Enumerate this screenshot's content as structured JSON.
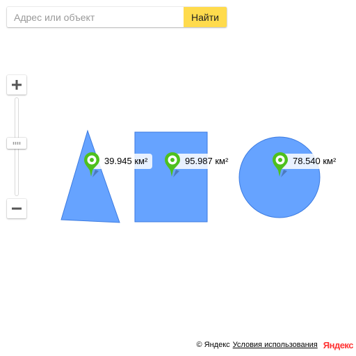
{
  "search": {
    "placeholder": "Адрес или объект",
    "button_label": "Найти"
  },
  "zoom": {
    "zoom_in_icon": "plus-icon",
    "zoom_out_icon": "minus-icon"
  },
  "shapes": [
    {
      "type": "triangle",
      "area_label": "39.945 км²"
    },
    {
      "type": "rectangle",
      "area_label": "95.987 км²"
    },
    {
      "type": "circle",
      "area_label": "78.540 км²"
    }
  ],
  "colors": {
    "shape_fill": "#66a3ff",
    "shape_stroke": "#3b7ae0",
    "pin_green": "#4ec01d",
    "search_button": "#ffdb4d",
    "brand_red": "#ff3333"
  },
  "footer": {
    "copyright": "© Яндекс",
    "terms": "Условия использования",
    "logo": "Яндекс"
  }
}
